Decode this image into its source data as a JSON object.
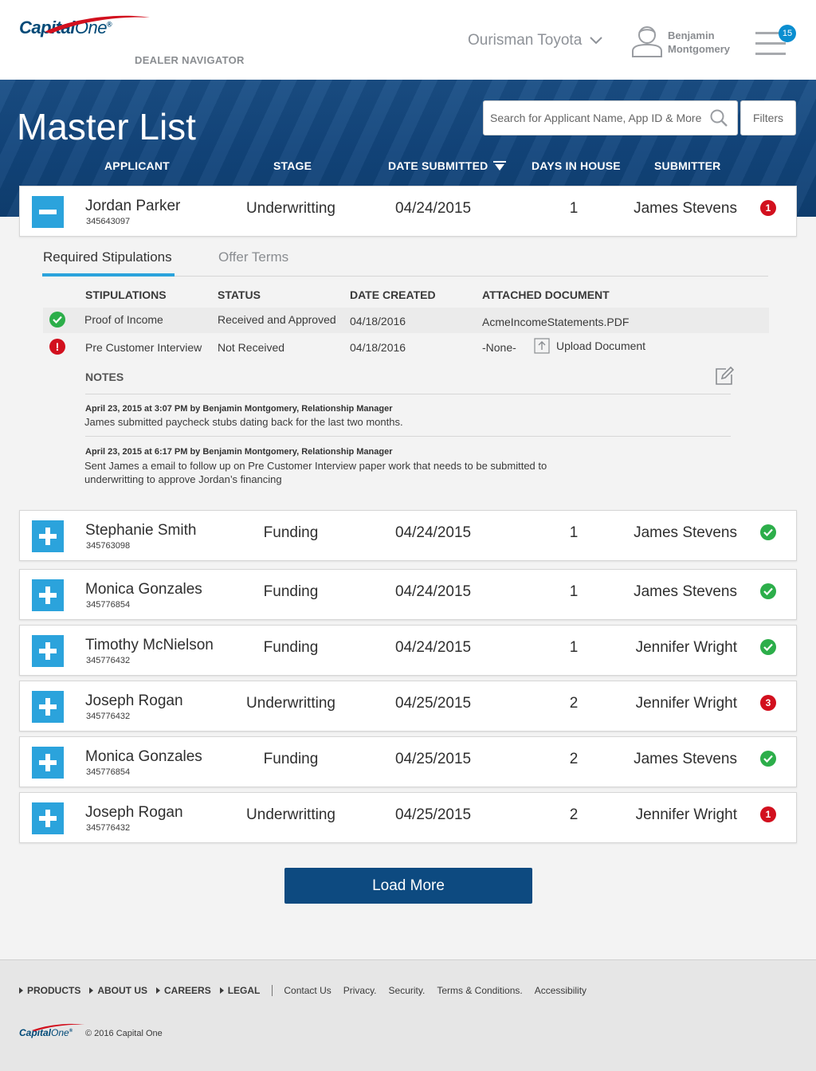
{
  "header": {
    "logo_main": "Capital",
    "logo_one": "One",
    "logo_mark": "®",
    "product": "DEALER NAVIGATOR",
    "dealer": "Ourisman Toyota",
    "user_first": "Benjamin",
    "user_last": "Montgomery",
    "notifications": "15"
  },
  "banner": {
    "title": "Master List",
    "search_placeholder": "Search for Applicant Name, App ID & More",
    "filters_label": "Filters"
  },
  "columns": {
    "applicant": "APPLICANT",
    "stage": "STAGE",
    "date_submitted": "DATE SUBMITTED",
    "days_in_house": "DAYS IN HOUSE",
    "submitter": "SUBMITTER"
  },
  "rows": [
    {
      "name": "Jordan Parker",
      "id": "345643097",
      "stage": "Underwritting",
      "date": "04/24/2015",
      "days": "1",
      "submitter": "James Stevens",
      "status": "alert",
      "count": "1",
      "expanded": true
    },
    {
      "name": "Stephanie Smith",
      "id": "345763098",
      "stage": "Funding",
      "date": "04/24/2015",
      "days": "1",
      "submitter": "James Stevens",
      "status": "ok",
      "count": ""
    },
    {
      "name": "Monica Gonzales",
      "id": "345776854",
      "stage": "Funding",
      "date": "04/24/2015",
      "days": "1",
      "submitter": "James Stevens",
      "status": "ok",
      "count": ""
    },
    {
      "name": "Timothy McNielson",
      "id": "345776432",
      "stage": "Funding",
      "date": "04/24/2015",
      "days": "1",
      "submitter": "Jennifer Wright",
      "status": "ok",
      "count": ""
    },
    {
      "name": "Joseph Rogan",
      "id": "345776432",
      "stage": "Underwritting",
      "date": "04/25/2015",
      "days": "2",
      "submitter": "Jennifer Wright",
      "status": "alert",
      "count": "3"
    },
    {
      "name": "Monica Gonzales",
      "id": "345776854",
      "stage": "Funding",
      "date": "04/25/2015",
      "days": "2",
      "submitter": "James Stevens",
      "status": "ok",
      "count": ""
    },
    {
      "name": "Joseph Rogan",
      "id": "345776432",
      "stage": "Underwritting",
      "date": "04/25/2015",
      "days": "2",
      "submitter": "Jennifer Wright",
      "status": "alert",
      "count": "1"
    }
  ],
  "detail": {
    "tabs": [
      "Required Stipulations",
      "Offer Terms"
    ],
    "stip_headers": {
      "stipulations": "STIPULATIONS",
      "status": "STATUS",
      "date_created": "DATE CREATED",
      "attached": "ATTACHED DOCUMENT"
    },
    "stipulations": [
      {
        "name": "Proof of Income",
        "status": "Received and Approved",
        "date": "04/18/2016",
        "document": "AcmeIncomeStatements.PDF",
        "state": "ok"
      },
      {
        "name": "Pre Customer Interview",
        "status": "Not Received",
        "date": "04/18/2016",
        "document": "-None-",
        "state": "alert",
        "icon_glyph": "!"
      }
    ],
    "upload_label": "Upload Document",
    "notes_label": "NOTES",
    "notes": [
      {
        "meta": "April 23, 2015 at 3:07 PM by Benjamin Montgomery, Relationship Manager",
        "text": "James submitted paycheck stubs dating back for the last two months."
      },
      {
        "meta": "April 23, 2015 at 6:17 PM by Benjamin Montgomery, Relationship Manager",
        "text": "Sent James a email to follow up on Pre Customer Interview paper work that needs to be submitted to underwritting to approve Jordan’s financing"
      }
    ]
  },
  "load_more": "Load More",
  "footer": {
    "main_links": [
      "PRODUCTS",
      "ABOUT US",
      "CAREERS",
      "LEGAL"
    ],
    "sub_links": [
      "Contact Us",
      "Privacy.",
      "Security.",
      "Terms & Conditions.",
      "Accessibility"
    ],
    "copyright": "© 2016 Capital One",
    "logo_main": "Capital",
    "logo_one": "One",
    "logo_mark": "®"
  },
  "colors": {
    "brand": "#004977",
    "accent": "#2ba3dc",
    "alert": "#d2101e",
    "ok": "#2cae4a",
    "button": "#0d4a80"
  }
}
